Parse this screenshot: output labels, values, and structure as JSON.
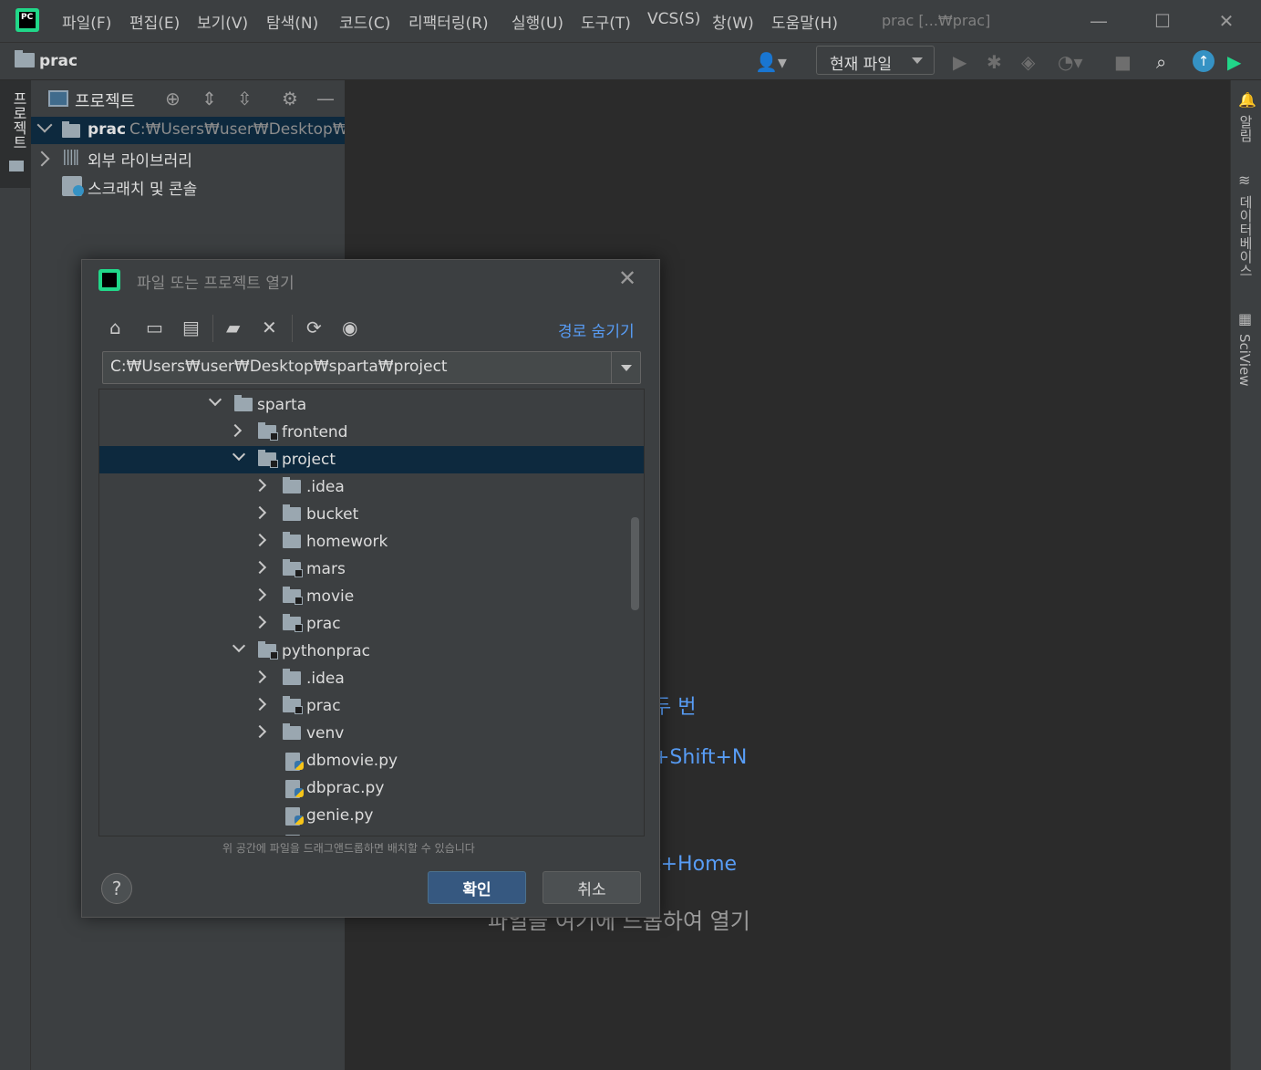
{
  "menubar": {
    "items": [
      "파일(F)",
      "편집(E)",
      "보기(V)",
      "탐색(N)",
      "코드(C)",
      "리팩터링(R)",
      "실행(U)",
      "도구(T)",
      "VCS(S)",
      "창(W)",
      "도움말(H)"
    ],
    "window_title": "prac [...₩prac]",
    "logo_text": "PC"
  },
  "navbar": {
    "project": "prac",
    "run_config": "현재 파일"
  },
  "left_strip": {
    "tab_label": "프로젝트"
  },
  "project_panel": {
    "title": "프로젝트",
    "tree": {
      "root_name": "prac",
      "root_path": "C:₩Users₩user₩Desktop₩sp",
      "external_libs": "외부 라이브러리",
      "scratches": "스크래치 및 콘솔"
    }
  },
  "editor": {
    "hints": [
      "두 번",
      "+Shift+N",
      "t+Home"
    ],
    "drop_hint": "파일을 여기에 드롭하여 열기"
  },
  "right_strip": {
    "notifications": "알림",
    "database": "데이터베이스",
    "sciview": "SciView"
  },
  "dialog": {
    "title": "파일 또는 프로젝트 열기",
    "logo_text": "PC",
    "hide_path": "경로 숨기기",
    "path": "C:₩Users₩user₩Desktop₩sparta₩project",
    "tree": [
      {
        "label": "sparta"
      },
      {
        "label": "frontend"
      },
      {
        "label": "project"
      },
      {
        "label": ".idea"
      },
      {
        "label": "bucket"
      },
      {
        "label": "homework"
      },
      {
        "label": "mars"
      },
      {
        "label": "movie"
      },
      {
        "label": "prac"
      },
      {
        "label": "pythonprac"
      },
      {
        "label": ".idea"
      },
      {
        "label": "prac"
      },
      {
        "label": "venv"
      },
      {
        "label": "dbmovie.py"
      },
      {
        "label": "dbprac.py"
      },
      {
        "label": "genie.py"
      }
    ],
    "dnd_hint": "위 공간에 파일을 드래그앤드롭하면 배치할 수 있습니다",
    "help": "?",
    "ok": "확인",
    "cancel": "취소"
  }
}
